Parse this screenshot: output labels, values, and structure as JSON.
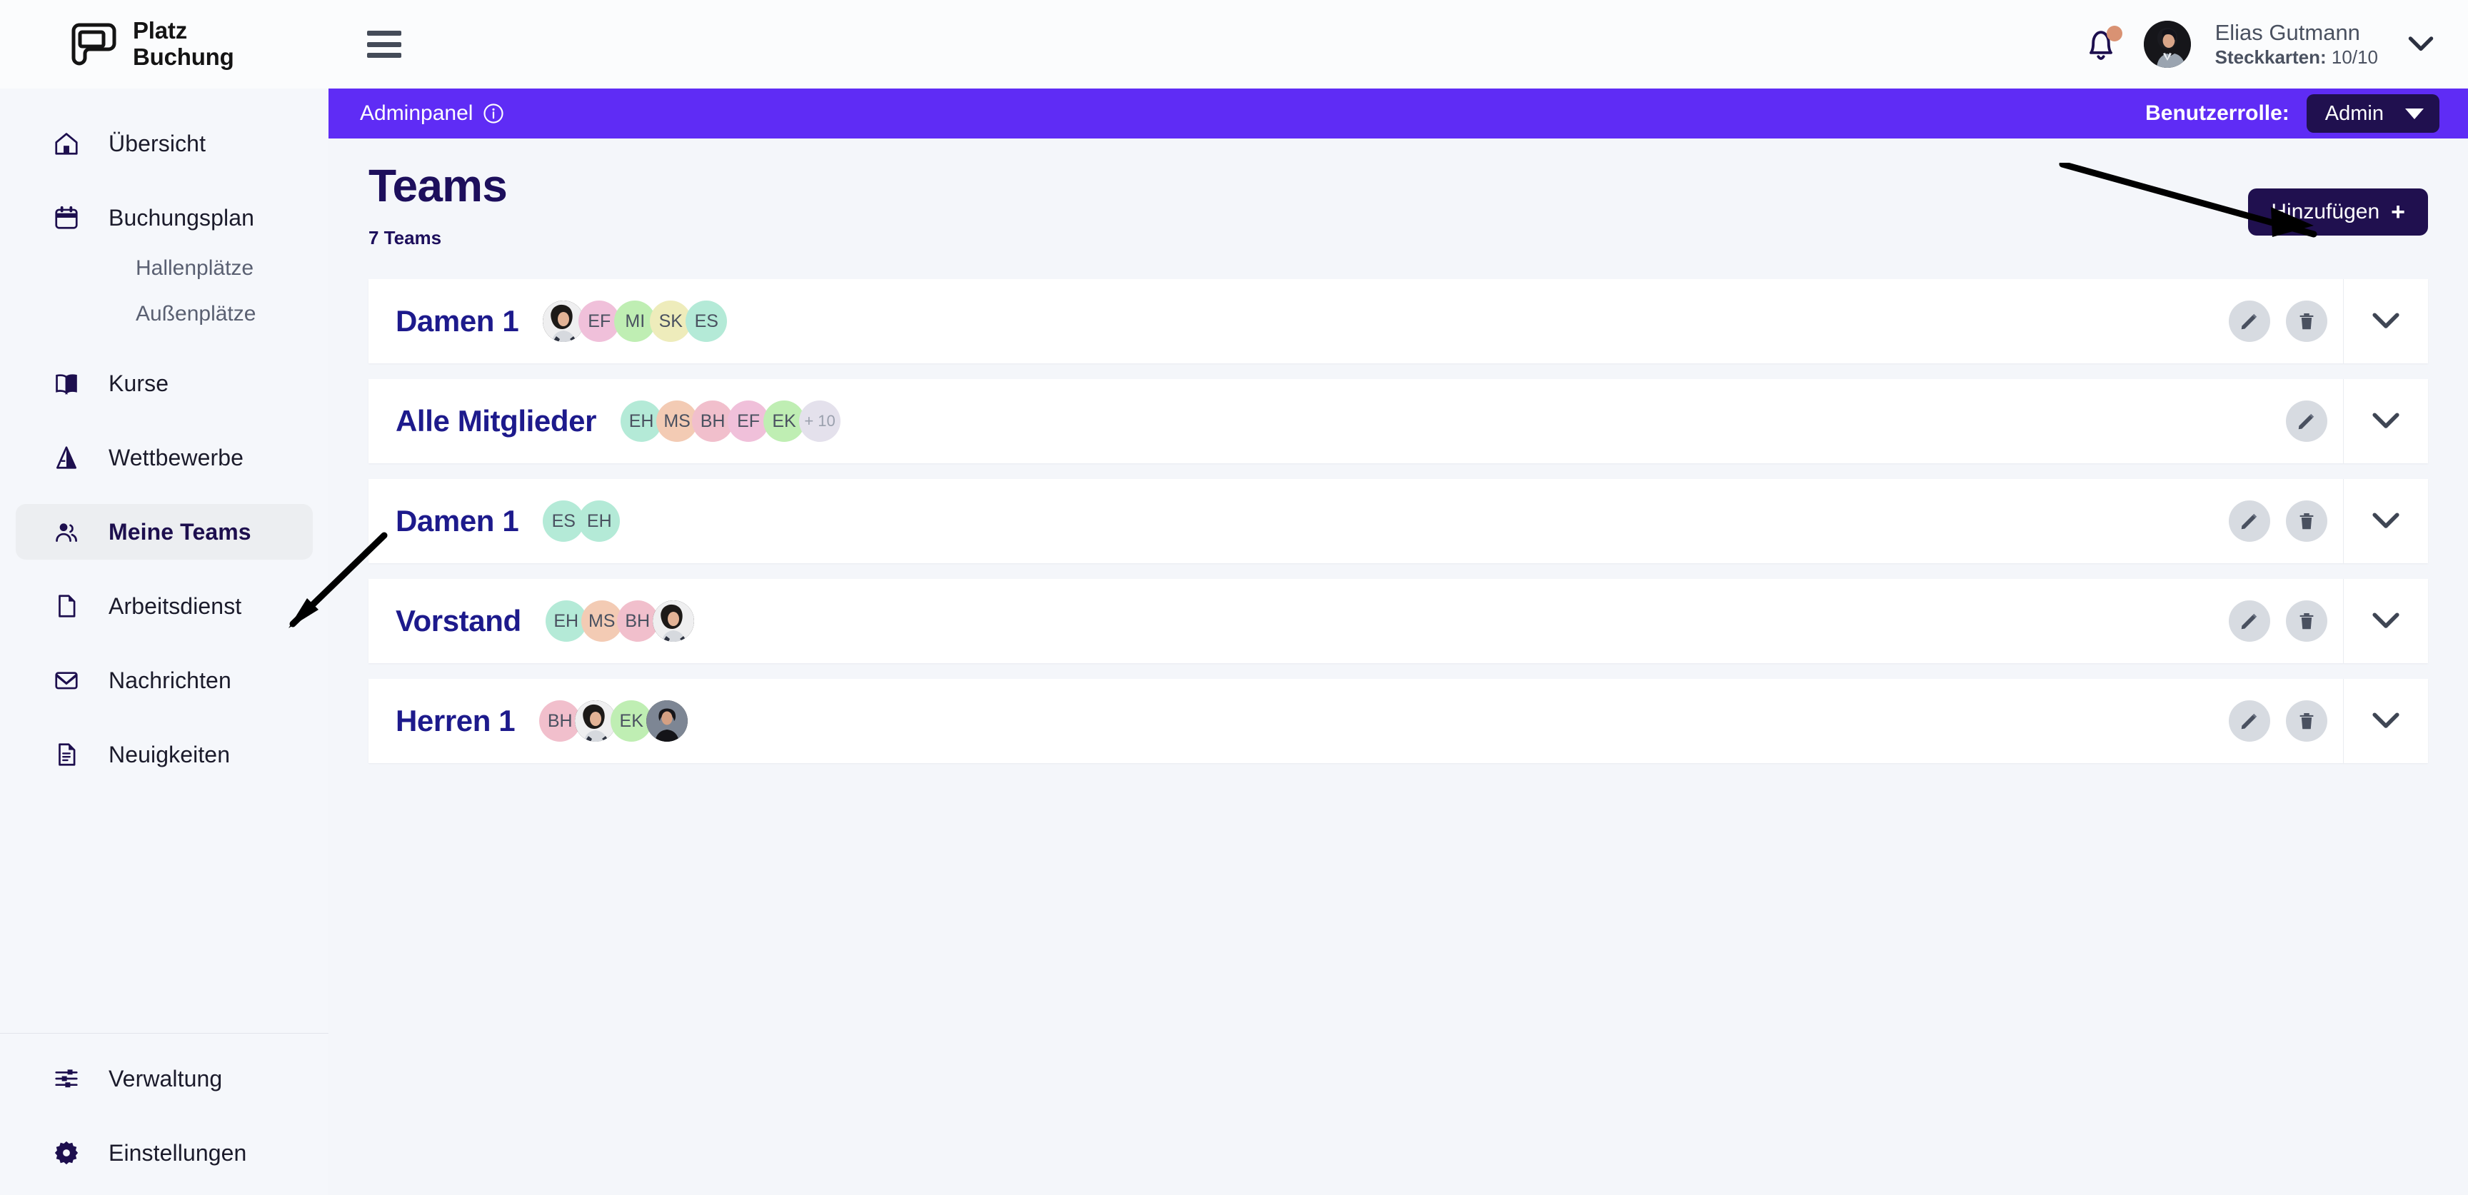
{
  "brand": {
    "line1": "Platz",
    "line2": "Buchung",
    "logo_icon": "platz-buchung-logo"
  },
  "sidebar": {
    "items": [
      {
        "label": "Übersicht",
        "icon": "home-icon",
        "active": false
      },
      {
        "label": "Buchungsplan",
        "icon": "calendar-icon",
        "active": false
      },
      {
        "label": "Kurse",
        "icon": "book-icon",
        "active": false
      },
      {
        "label": "Wettbewerbe",
        "icon": "trophy-icon",
        "active": false
      },
      {
        "label": "Meine Teams",
        "icon": "users-icon",
        "active": true
      },
      {
        "label": "Arbeitsdienst",
        "icon": "file-icon",
        "active": false
      },
      {
        "label": "Nachrichten",
        "icon": "envelope-icon",
        "active": false
      },
      {
        "label": "Neuigkeiten",
        "icon": "news-icon",
        "active": false
      }
    ],
    "sub_items": [
      {
        "label": "Hallenplätze"
      },
      {
        "label": "Außenplätze"
      }
    ],
    "bottom_items": [
      {
        "label": "Verwaltung",
        "icon": "sliders-icon"
      },
      {
        "label": "Einstellungen",
        "icon": "gear-icon"
      }
    ]
  },
  "topbar": {
    "menu_icon": "hamburger-icon",
    "bell_icon": "bell-icon",
    "has_notification": true,
    "user_name": "Elias Gutmann",
    "user_sub_label": "Steckkarten:",
    "user_sub_value": "10/10",
    "chevron_icon": "chevron-down-icon"
  },
  "adminbar": {
    "title": "Adminpanel",
    "info_icon": "info-circle-icon",
    "role_label": "Benutzerrolle:",
    "role_value": "Admin",
    "role_options": [
      "Admin"
    ],
    "bg_color": "#5f2cf5",
    "select_bg_color": "#20104f"
  },
  "page": {
    "title": "Teams",
    "count_label": "7 Teams",
    "add_button_label": "Hinzufügen",
    "add_button_plus": "+"
  },
  "teams": [
    {
      "name": "Damen 1",
      "members": [
        {
          "type": "photo",
          "initials": "",
          "color": "#3a3a3a"
        },
        {
          "type": "initials",
          "initials": "EF",
          "color": "#f0c0da"
        },
        {
          "type": "initials",
          "initials": "MI",
          "color": "#bfeeb3"
        },
        {
          "type": "initials",
          "initials": "SK",
          "color": "#eeecbb"
        },
        {
          "type": "initials",
          "initials": "ES",
          "color": "#b4ead7"
        }
      ],
      "overflow": "",
      "has_edit": true,
      "has_delete": true
    },
    {
      "name": "Alle Mitglieder",
      "members": [
        {
          "type": "initials",
          "initials": "EH",
          "color": "#b4ead7"
        },
        {
          "type": "initials",
          "initials": "MS",
          "color": "#f3cbb4"
        },
        {
          "type": "initials",
          "initials": "BH",
          "color": "#f1bfcc"
        },
        {
          "type": "initials",
          "initials": "EF",
          "color": "#f0c0da"
        },
        {
          "type": "initials",
          "initials": "EK",
          "color": "#bfeeb3"
        }
      ],
      "overflow": "+ 10",
      "has_edit": true,
      "has_delete": false
    },
    {
      "name": "Damen 1",
      "members": [
        {
          "type": "initials",
          "initials": "ES",
          "color": "#b4ead7"
        },
        {
          "type": "initials",
          "initials": "EH",
          "color": "#b4ead7"
        }
      ],
      "overflow": "",
      "has_edit": true,
      "has_delete": true
    },
    {
      "name": "Vorstand",
      "members": [
        {
          "type": "initials",
          "initials": "EH",
          "color": "#b4ead7"
        },
        {
          "type": "initials",
          "initials": "MS",
          "color": "#f3cbb4"
        },
        {
          "type": "initials",
          "initials": "BH",
          "color": "#f1bfcc"
        },
        {
          "type": "photo",
          "initials": "",
          "color": "#3a3a3a"
        }
      ],
      "overflow": "",
      "has_edit": true,
      "has_delete": true
    },
    {
      "name": "Herren 1",
      "members": [
        {
          "type": "initials",
          "initials": "BH",
          "color": "#f1bfcc"
        },
        {
          "type": "photo",
          "initials": "",
          "color": "#3a3a3a"
        },
        {
          "type": "initials",
          "initials": "EK",
          "color": "#bfeeb3"
        },
        {
          "type": "photo",
          "initials": "",
          "color": "#272727"
        }
      ],
      "overflow": "",
      "has_edit": true,
      "has_delete": true
    }
  ],
  "row_actions": {
    "edit_icon": "pencil-icon",
    "delete_icon": "trash-icon",
    "expand_icon": "chevron-down-icon"
  },
  "annotations": [
    {
      "name": "arrow-to-add-button",
      "points_to": "Hinzufügen"
    },
    {
      "name": "arrow-to-meine-teams",
      "points_to": "Meine Teams"
    }
  ],
  "colors": {
    "accent_purple": "#5f2cf5",
    "navy": "#20104f",
    "title_navy": "#1d0f5c",
    "team_name": "#1d1a8c",
    "page_bg": "#f4f6fa",
    "overflow_chip": "#e4e1ec"
  }
}
